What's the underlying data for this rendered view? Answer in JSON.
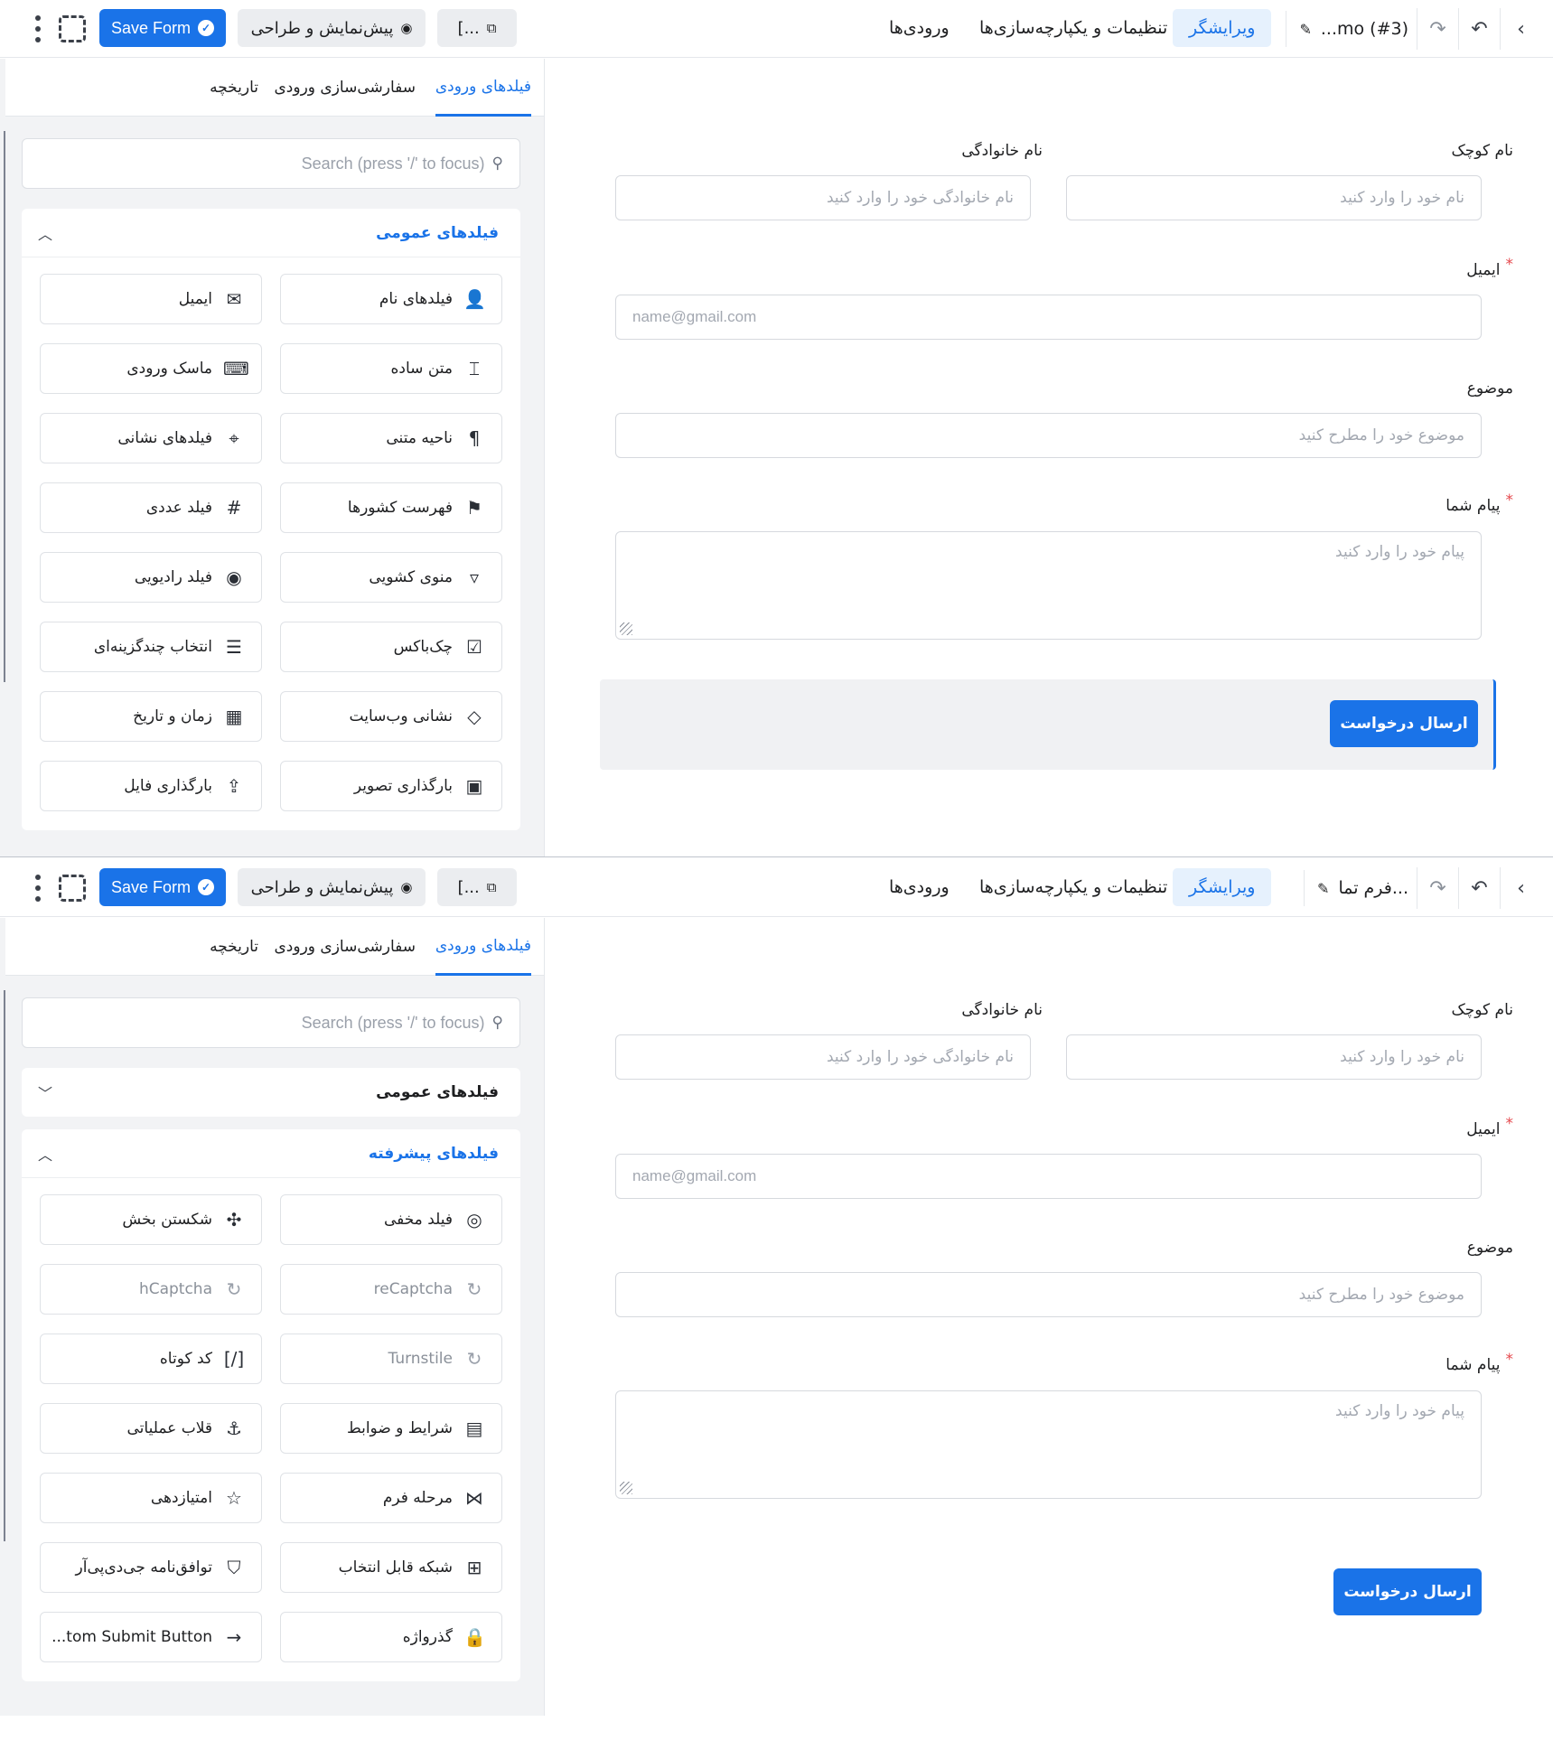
{
  "frames": [
    {
      "topbar": {
        "back_icon": "chevron-left-icon",
        "undo_icon": "undo-icon",
        "redo_icon": "redo-icon",
        "form_title": "...mo (#3)",
        "tabs": [
          "ویرایشگر",
          "تنظیمات و یکپارچه‌سازی‌ها",
          "ورودی‌ها"
        ],
        "active_tab": "ویرایشگر",
        "shortcode_label": "[...",
        "preview_label": "پیش‌نمایش و طراحی",
        "save_label": "Save Form"
      },
      "sidebar": {
        "tabs": [
          "فیلدهای ورودی",
          "سفارشی‌سازی ورودی",
          "تاریخچه"
        ],
        "search_placeholder": "Search (press '/' to focus)",
        "groups": [
          {
            "title": "فیلدهای عمومی",
            "expanded": true,
            "items": [
              {
                "label": "فیلدهای نام",
                "icon": "user-icon",
                "glyph": "👤",
                "enabled": true
              },
              {
                "label": "ایمیل",
                "icon": "envelope-icon",
                "glyph": "✉",
                "enabled": true
              },
              {
                "label": "متن ساده",
                "icon": "text-cursor-icon",
                "glyph": "⌶",
                "enabled": true
              },
              {
                "label": "ماسک ورودی",
                "icon": "keyboard-icon",
                "glyph": "⌨",
                "enabled": true
              },
              {
                "label": "ناحیه متنی",
                "icon": "paragraph-icon",
                "glyph": "¶",
                "enabled": true
              },
              {
                "label": "فیلدهای نشانی",
                "icon": "map-pin-icon",
                "glyph": "⌖",
                "enabled": true
              },
              {
                "label": "فهرست کشورها",
                "icon": "flag-icon",
                "glyph": "⚑",
                "enabled": true
              },
              {
                "label": "فیلد عددی",
                "icon": "hash-icon",
                "glyph": "#",
                "enabled": true
              },
              {
                "label": "منوی کشویی",
                "icon": "dropdown-icon",
                "glyph": "▿",
                "enabled": true
              },
              {
                "label": "فیلد رادیویی",
                "icon": "radio-icon",
                "glyph": "◉",
                "enabled": true
              },
              {
                "label": "چک‌باکس",
                "icon": "checkbox-icon",
                "glyph": "☑",
                "enabled": true
              },
              {
                "label": "انتخاب چندگزینه‌ای",
                "icon": "list-icon",
                "glyph": "☰",
                "enabled": true
              },
              {
                "label": "نشانی وب‌سایت",
                "icon": "link-icon",
                "glyph": "◇",
                "enabled": true
              },
              {
                "label": "زمان و تاریخ",
                "icon": "calendar-icon",
                "glyph": "▦",
                "enabled": true
              },
              {
                "label": "بارگذاری تصویر",
                "icon": "image-upload-icon",
                "glyph": "▣",
                "enabled": true
              },
              {
                "label": "بارگذاری فایل",
                "icon": "upload-icon",
                "glyph": "⇪",
                "enabled": true
              }
            ]
          }
        ]
      },
      "form": {
        "first_name_label": "نام کوچک",
        "first_name_placeholder": "نام خود را وارد کنید",
        "last_name_label": "نام خانوادگی",
        "last_name_placeholder": "نام خانوادگی خود را وارد کنید",
        "email_label": "ایمیل",
        "email_placeholder": "name@gmail.com",
        "subject_label": "موضوع",
        "subject_placeholder": "موضوع خود را مطرح کنید",
        "message_label": "پیام شما",
        "message_placeholder": "پیام خود را وارد کنید",
        "required_mark": "*",
        "submit_label": "ارسال درخواست",
        "submit_selected": true
      }
    },
    {
      "topbar": {
        "back_icon": "chevron-left-icon",
        "undo_icon": "undo-icon",
        "redo_icon": "redo-icon",
        "form_title": "فرم تما...",
        "tabs": [
          "ویرایشگر",
          "تنظیمات و یکپارچه‌سازی‌ها",
          "ورودی‌ها"
        ],
        "active_tab": "ویرایشگر",
        "shortcode_label": "[...",
        "preview_label": "پیش‌نمایش و طراحی",
        "save_label": "Save Form"
      },
      "sidebar": {
        "tabs": [
          "فیلدهای ورودی",
          "سفارشی‌سازی ورودی",
          "تاریخچه"
        ],
        "search_placeholder": "Search (press '/' to focus)",
        "groups": [
          {
            "title": "فیلدهای عمومی",
            "expanded": false,
            "items": []
          },
          {
            "title": "فیلدهای پیشرفته",
            "expanded": true,
            "items": [
              {
                "label": "فیلد مخفی",
                "icon": "eye-off-icon",
                "glyph": "◎",
                "enabled": true
              },
              {
                "label": "شکستن بخش",
                "icon": "puzzle-icon",
                "glyph": "✣",
                "enabled": true
              },
              {
                "label": "reCaptcha",
                "icon": "recaptcha-icon",
                "glyph": "↻",
                "enabled": false
              },
              {
                "label": "hCaptcha",
                "icon": "hcaptcha-icon",
                "glyph": "↻",
                "enabled": false
              },
              {
                "label": "Turnstile",
                "icon": "turnstile-icon",
                "glyph": "↻",
                "enabled": false
              },
              {
                "label": "کد کوتاه",
                "icon": "shortcode-icon",
                "glyph": "[/]",
                "enabled": true
              },
              {
                "label": "شرایط و ضوابط",
                "icon": "document-icon",
                "glyph": "▤",
                "enabled": true
              },
              {
                "label": "قلاب عملیاتی",
                "icon": "hook-icon",
                "glyph": "⚓",
                "enabled": true
              },
              {
                "label": "مرحله فرم",
                "icon": "step-icon",
                "glyph": "⋈",
                "enabled": true
              },
              {
                "label": "امتیازدهی",
                "icon": "star-icon",
                "glyph": "☆",
                "enabled": true
              },
              {
                "label": "شبکه قابل انتخاب",
                "icon": "grid-icon",
                "glyph": "⊞",
                "enabled": true
              },
              {
                "label": "توافق‌نامه جی‌دی‌پی‌آر",
                "icon": "shield-icon",
                "glyph": "⛉",
                "enabled": true
              },
              {
                "label": "گذرواژه",
                "icon": "lock-icon",
                "glyph": "🔒",
                "enabled": true
              },
              {
                "label": "...tom Submit Button",
                "icon": "arrow-right-icon",
                "glyph": "→",
                "enabled": true
              }
            ]
          }
        ]
      },
      "form": {
        "first_name_label": "نام کوچک",
        "first_name_placeholder": "نام خود را وارد کنید",
        "last_name_label": "نام خانوادگی",
        "last_name_placeholder": "نام خانوادگی خود را وارد کنید",
        "email_label": "ایمیل",
        "email_placeholder": "name@gmail.com",
        "subject_label": "موضوع",
        "subject_placeholder": "موضوع خود را مطرح کنید",
        "message_label": "پیام شما",
        "message_placeholder": "پیام خود را وارد کنید",
        "required_mark": "*",
        "submit_label": "ارسال درخواست",
        "submit_selected": false
      }
    }
  ],
  "colors": {
    "accent": "#1a73e8",
    "active_tab_bg": "#e6f1fd",
    "sidebar_bg": "#f2f3f5",
    "required": "#e5484d"
  }
}
